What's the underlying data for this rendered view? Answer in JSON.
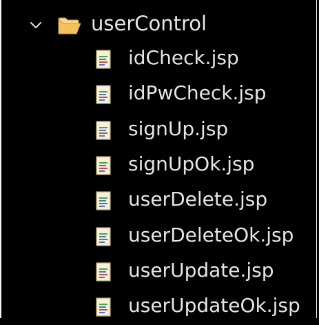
{
  "tree": {
    "folder": {
      "name": "userControl",
      "expanded": true,
      "chevron_icon": "chevron-down-icon",
      "icon": "folder-open-icon",
      "icon_color": "#f3c35a"
    },
    "files": [
      {
        "label": "idCheck.jsp",
        "icon": "jsp-file-icon"
      },
      {
        "label": "idPwCheck.jsp",
        "icon": "jsp-file-icon"
      },
      {
        "label": "signUp.jsp",
        "icon": "jsp-file-icon"
      },
      {
        "label": "signUpOk.jsp",
        "icon": "jsp-file-icon"
      },
      {
        "label": "userDelete.jsp",
        "icon": "jsp-file-icon"
      },
      {
        "label": "userDeleteOk.jsp",
        "icon": "jsp-file-icon"
      },
      {
        "label": "userUpdate.jsp",
        "icon": "jsp-file-icon"
      },
      {
        "label": "userUpdateOk.jsp",
        "icon": "jsp-file-icon"
      }
    ],
    "colors": {
      "background": "#000000",
      "text": "#e6e6e6",
      "file_icon_body": "#f4f0dc",
      "file_icon_border": "#b9a76f",
      "file_icon_line_green": "#48a64a",
      "file_icon_line_blue": "#4b74c8",
      "file_icon_line_red": "#c94b4b"
    }
  }
}
